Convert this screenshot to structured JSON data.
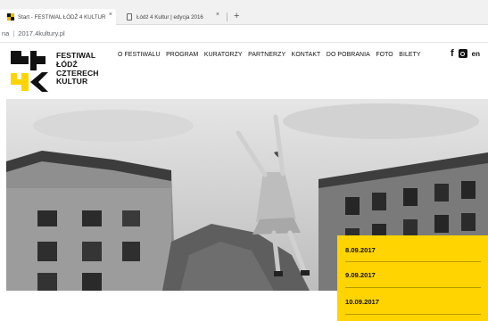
{
  "browser": {
    "tabs": [
      {
        "title": "Start - FESTIWAL ŁÓDŹ 4 KULTUR",
        "close": "×",
        "active": true
      },
      {
        "title": "Łódź 4 Kultur | edycja 2016",
        "close": "×",
        "active": false
      }
    ],
    "new_tab": "+",
    "address_prefix": "na",
    "address_url": "2017.4kultury.pl"
  },
  "site": {
    "brand": [
      "FESTIWAL",
      "ŁÓDŹ",
      "CZTERECH",
      "KULTUR"
    ],
    "nav": [
      "O FESTIWALU",
      "PROGRAM",
      "KURATORZY",
      "PARTNERZY",
      "KONTAKT",
      "DO POBRANIA",
      "FOTO",
      "BILETY"
    ],
    "social": {
      "facebook": "f",
      "instagram_icon": "instagram-icon"
    },
    "language": "en",
    "accent_color": "#ffd400",
    "dates": [
      "8.09.2017",
      "9.09.2017",
      "10.09.2017"
    ]
  }
}
